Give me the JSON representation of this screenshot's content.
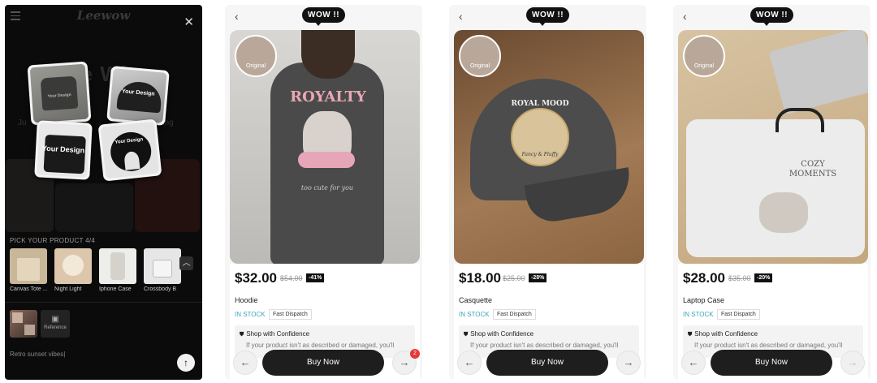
{
  "app": {
    "brand": "Leewow",
    "hero_title": "Make Wh",
    "hero_sub_left": "Ju",
    "hero_sub_right": "thing",
    "cards": {
      "bag": "Your Design",
      "cap": "Your Design",
      "tote": "Your Design",
      "pillow": "Your Design"
    },
    "pick_title": "PICK YOUR PRODUCT",
    "pick_count": "4/4",
    "products": [
      {
        "name": "Canvas Tote ..."
      },
      {
        "name": "Night Light"
      },
      {
        "name": "Iphone Case"
      },
      {
        "name": "Crossbody B"
      }
    ],
    "reference_label": "Reference",
    "prompt_text": "Retro sunset vibes|"
  },
  "wow_label": "WOW !!",
  "original_label": "Original",
  "stock_label": "IN STOCK",
  "dispatch_label": "Fast Dispatch",
  "confidence_title": "Shop with Confidence",
  "confidence_text": "If your product isn't as described or damaged, you'll",
  "buy_label": "Buy Now",
  "cart_count": "2",
  "product_panels": [
    {
      "price": "$32.00",
      "old_price": "$54.00",
      "discount": "-41%",
      "name": "Hoodie",
      "design_title": "ROYALTY",
      "design_sub": "too cute for you"
    },
    {
      "price": "$18.00",
      "old_price": "$25.00",
      "discount": "-28%",
      "name": "Casquette",
      "design_title": "ROYAL MOOD",
      "design_sub": "Fancy & Fluffy"
    },
    {
      "price": "$28.00",
      "old_price": "$35.00",
      "discount": "-20%",
      "name": "Laptop Case",
      "design_title": "COZY MOMENTS",
      "design_sub": ""
    }
  ],
  "colors": {
    "dark_bg": "#0b0b0b",
    "accent_stock": "#3aa7b7",
    "discount_bg": "#111111",
    "badge_red": "#e53935"
  }
}
